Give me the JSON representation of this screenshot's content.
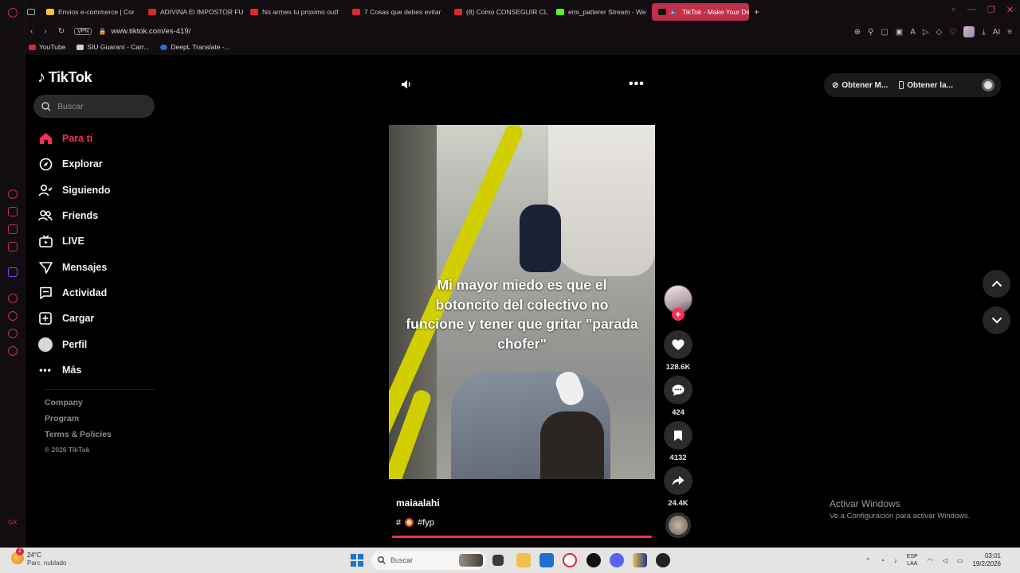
{
  "browser": {
    "tabs": [
      {
        "label": "Envios e-commerce | Cor",
        "active": false
      },
      {
        "label": "ADIVINA El IMPOSTOR FU",
        "active": false
      },
      {
        "label": "No armes tu proximo outf",
        "active": false
      },
      {
        "label": "7 Cosas que debes evitar",
        "active": false
      },
      {
        "label": "(8) Como CONSEGUIR CL",
        "active": false
      },
      {
        "label": "emi_patterer Stream - We",
        "active": false
      },
      {
        "label": "TikTok - Make Your De",
        "active": true
      }
    ],
    "new_tab": "+",
    "vpn_label": "VPN",
    "url": "www.tiktok.com/es-419/",
    "toolbar_ai": "AI",
    "bookmarks": [
      {
        "label": "YouTube",
        "icon": "youtube-icon"
      },
      {
        "label": "SIU Guaraní - Carr...",
        "icon": "siu-icon"
      },
      {
        "label": "DeepL Translate -...",
        "icon": "deepl-icon"
      }
    ]
  },
  "tiktok": {
    "brand": "TikTok",
    "search_placeholder": "Buscar",
    "nav": [
      {
        "label": "Para ti",
        "icon": "home-icon",
        "active": true
      },
      {
        "label": "Explorar",
        "icon": "compass-icon",
        "active": false
      },
      {
        "label": "Siguiendo",
        "icon": "following-icon",
        "active": false
      },
      {
        "label": "Friends",
        "icon": "friends-icon",
        "active": false
      },
      {
        "label": "LIVE",
        "icon": "live-icon",
        "active": false
      },
      {
        "label": "Mensajes",
        "icon": "messages-icon",
        "active": false
      },
      {
        "label": "Actividad",
        "icon": "activity-icon",
        "active": false
      },
      {
        "label": "Cargar",
        "icon": "upload-icon",
        "active": false
      },
      {
        "label": "Perfil",
        "icon": "profile-avatar",
        "active": false
      },
      {
        "label": "Más",
        "icon": "more-icon",
        "active": false
      }
    ],
    "footer": {
      "company": "Company",
      "program": "Program",
      "terms": "Terms & Policies",
      "copyright": "© 2026 TikTok"
    },
    "top_actions": {
      "get_coins": "Obtener M...",
      "get_app": "Obtener la..."
    },
    "video": {
      "caption": "Mi mayor miedo es que el botoncito del colectivo no funcione y tener que gritar \"parada chofer\"",
      "author": "maiaalahi",
      "hashtag_prefix": "#",
      "hashtag": "#fyp",
      "progress": 1.0,
      "likes": "128.6K",
      "comments": "424",
      "saves": "4132",
      "shares": "24.4K",
      "more_dots": "•••"
    }
  },
  "windows": {
    "activate_title": "Activar Windows",
    "activate_sub": "Ve a Configuración para activar Windows.",
    "weather_temp": "24°C",
    "weather_cond": "Parc. nublado",
    "weather_badge": "2",
    "search_placeholder": "Buscar",
    "lang_line1": "ESP",
    "lang_line2": "LAA",
    "time": "03:01",
    "date": "19/2/2026"
  }
}
